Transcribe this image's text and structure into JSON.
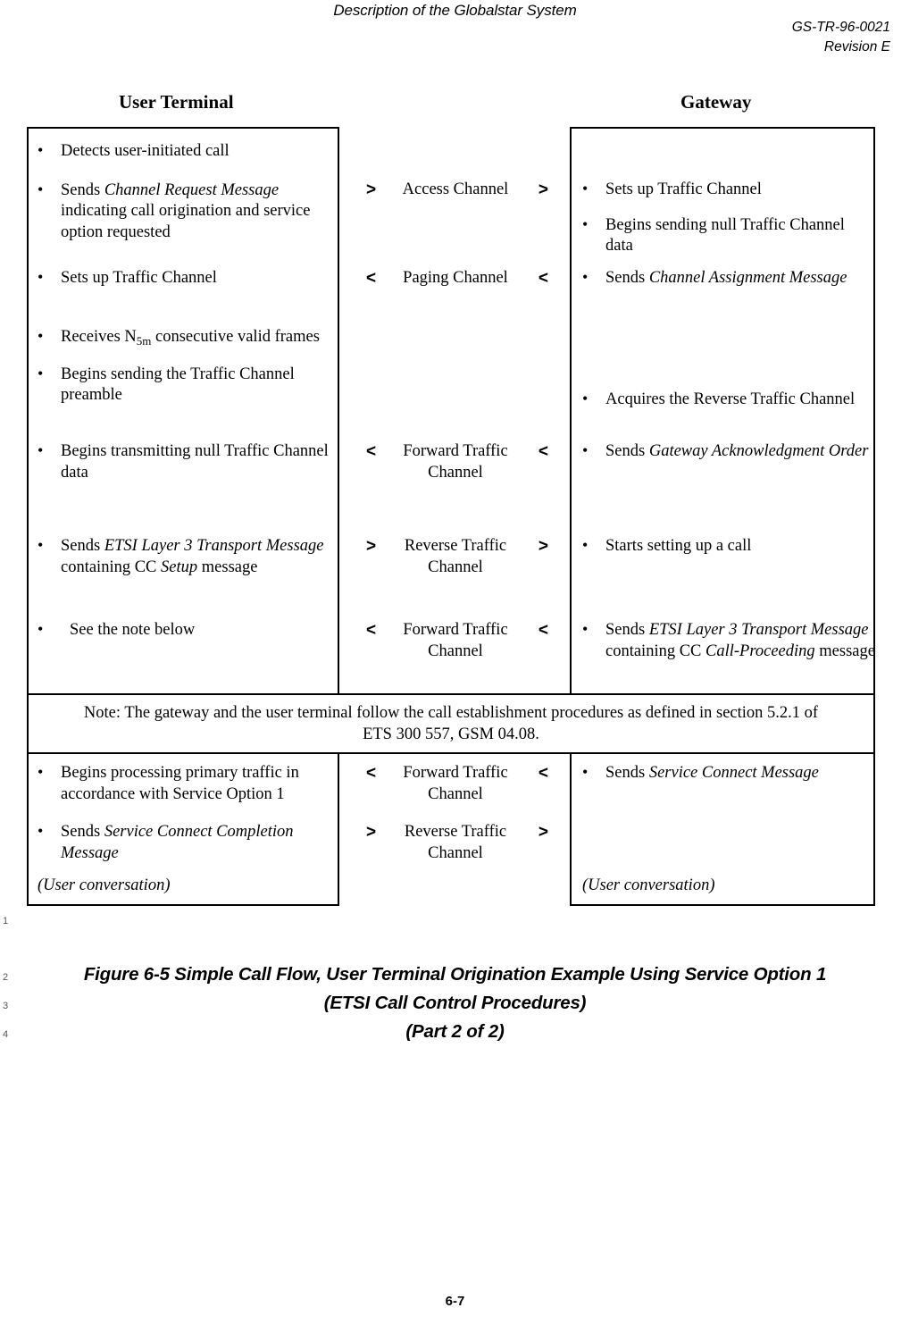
{
  "header": {
    "running_title": "Description of the Globalstar System",
    "doc_number": "GS-TR-96-0021",
    "revision": "Revision E"
  },
  "columns": {
    "left_title": "User Terminal",
    "right_title": "Gateway"
  },
  "rows": [
    {
      "left": [
        {
          "text": "Detects user-initiated call"
        },
        {
          "text": "Sends Channel Request Message indicating call origination and service option requested"
        }
      ],
      "channel": "Access Channel",
      "arrow_left": ">",
      "arrow_right": ">",
      "right": [
        {
          "text": "Sets up Traffic Channel"
        },
        {
          "text": "Begins sending null Traffic Channel data"
        }
      ]
    },
    {
      "left": [
        {
          "text": "Sets up Traffic Channel"
        }
      ],
      "channel": "Paging Channel",
      "arrow_left": "<",
      "arrow_right": "<",
      "right": [
        {
          "text": "Sends Channel Assignment Message"
        }
      ]
    },
    {
      "left": [
        {
          "text": "Receives N5m consecutive valid frames"
        },
        {
          "text": "Begins sending the Traffic Channel preamble"
        }
      ],
      "channel": "",
      "arrow_left": "",
      "arrow_right": "",
      "right": [
        {
          "text": "Acquires the Reverse Traffic Channel"
        }
      ]
    },
    {
      "left": [
        {
          "text": "Begins transmitting null Traffic Channel data"
        }
      ],
      "channel": "Forward Traffic Channel",
      "arrow_left": "<",
      "arrow_right": "<",
      "right": [
        {
          "text": "Sends Gateway Acknowledgment Order"
        }
      ]
    },
    {
      "left": [
        {
          "text": "Sends ETSI Layer 3 Transport Message containing CC Setup message"
        }
      ],
      "channel": "Reverse Traffic Channel",
      "arrow_left": ">",
      "arrow_right": ">",
      "right": [
        {
          "text": "Starts setting up a call"
        }
      ]
    },
    {
      "left": [
        {
          "text": "See the note below"
        }
      ],
      "channel": "Forward Traffic Channel",
      "arrow_left": "<",
      "arrow_right": "<",
      "right": [
        {
          "text": "Sends ETSI Layer 3 Transport Message containing CC Call-Proceeding message"
        }
      ]
    },
    {
      "left": [
        {
          "text": "Begins processing primary traffic in accordance with Service Option 1"
        }
      ],
      "channel": "Forward Traffic Channel",
      "arrow_left": "<",
      "arrow_right": "<",
      "right": [
        {
          "text": "Sends Service Connect Message"
        }
      ]
    },
    {
      "left": [
        {
          "text": "Sends Service Connect Completion Message"
        }
      ],
      "channel": "Reverse Traffic Channel",
      "arrow_left": ">",
      "arrow_right": ">",
      "right": []
    }
  ],
  "note": {
    "line1": "Note: The gateway and the user terminal follow the call establishment procedures as defined in section 5.2.1 of",
    "line2": "ETS 300 557, GSM 04.08."
  },
  "user_conversation": {
    "left": "(User conversation)",
    "right": "(User conversation)"
  },
  "line_numbers": [
    "1",
    "2",
    "3",
    "4"
  ],
  "caption": {
    "line1": "Figure 6-5 Simple Call Flow, User Terminal Origination Example Using Service Option 1",
    "line2": "(ETSI Call Control Procedures)",
    "line3": "(Part 2 of 2)"
  },
  "footer": {
    "page_number": "6-7"
  },
  "colors": {
    "text": "#000000",
    "background": "#ffffff",
    "rule": "#000000"
  }
}
